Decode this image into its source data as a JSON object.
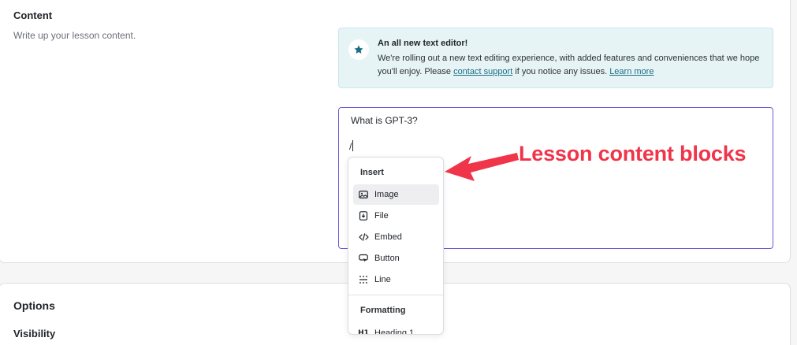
{
  "content_section": {
    "title": "Content",
    "description": "Write up your lesson content."
  },
  "notice": {
    "icon": "star-icon",
    "title": "An all new text editor!",
    "body_before": "We're rolling out a new text editing experience, with added features and conveniences that we hope you'll enjoy. Please ",
    "contact_link": "contact support",
    "body_middle": " if you notice any issues. ",
    "learn_link": "Learn more",
    "accent_color": "#1a6e85"
  },
  "editor": {
    "line1": "What is GPT-3?",
    "line2": "/",
    "focus_color": "#6b5cd6"
  },
  "insert_menu": {
    "insert_heading": "Insert",
    "items": [
      {
        "label": "Image",
        "icon": "image-icon",
        "active": true
      },
      {
        "label": "File",
        "icon": "file-icon"
      },
      {
        "label": "Embed",
        "icon": "code-icon"
      },
      {
        "label": "Button",
        "icon": "button-icon"
      },
      {
        "label": "Line",
        "icon": "line-icon"
      }
    ],
    "formatting_heading": "Formatting",
    "formatting_items": [
      {
        "label": "Heading 1",
        "icon": "heading-1-icon"
      }
    ]
  },
  "annotation": {
    "text": "Lesson content blocks",
    "color": "#f0344a"
  },
  "options_section": {
    "title": "Options",
    "visibility_title": "Visibility"
  }
}
